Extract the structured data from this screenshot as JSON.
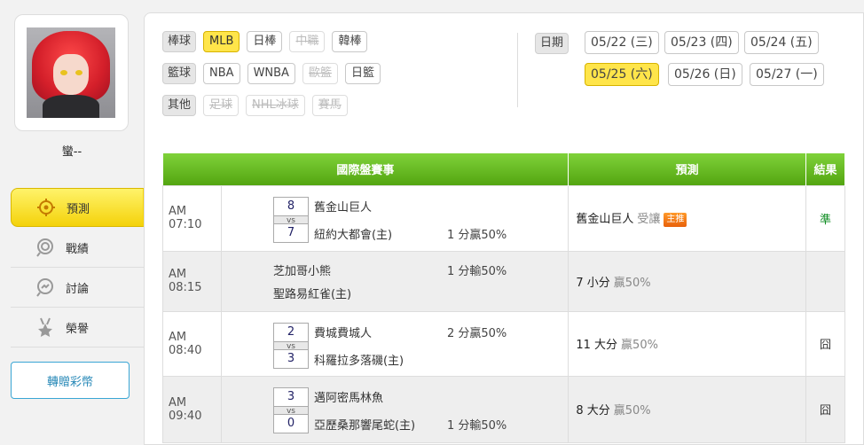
{
  "user": {
    "name": "蠻--"
  },
  "menu": [
    {
      "label": "預測",
      "icon": "target-icon",
      "active": true
    },
    {
      "label": "戰績",
      "icon": "record-icon",
      "active": false
    },
    {
      "label": "討論",
      "icon": "discuss-icon",
      "active": false
    },
    {
      "label": "榮譽",
      "icon": "medal-icon",
      "active": false
    }
  ],
  "gift_button": "轉贈彩幣",
  "filters": {
    "baseball": {
      "label": "棒球",
      "options": [
        "MLB",
        "日棒",
        "中職",
        "韓棒"
      ]
    },
    "basketball": {
      "label": "籃球",
      "options": [
        "NBA",
        "WNBA",
        "歐籃",
        "日籃"
      ]
    },
    "other": {
      "label": "其他",
      "options": [
        "足球",
        "NHL冰球",
        "賽馬"
      ]
    }
  },
  "dates": {
    "label": "日期",
    "options": [
      "05/22 (三)",
      "05/23 (四)",
      "05/24 (五)",
      "05/25 (六)",
      "05/26 (日)",
      "05/27 (一)"
    ],
    "selected": "05/25 (六)"
  },
  "table": {
    "headers": [
      "國際盤賽事",
      "預測",
      "結果"
    ],
    "rows": [
      {
        "time": "AM 07:10",
        "away_score": "8",
        "home_score": "7",
        "vs": "vs",
        "away": "舊金山巨人",
        "home": "紐約大都會(主)",
        "line": "1 分贏50%",
        "line_pos": "home",
        "pred_team": "舊金山巨人",
        "pred_sub": "受讓",
        "badge": "主推",
        "result": "準"
      },
      {
        "time": "AM 08:15",
        "away": "芝加哥小熊",
        "home": "聖路易紅雀(主)",
        "line": "1 分輸50%",
        "line_pos": "away",
        "pred_team": "7 小分",
        "pred_sub": "贏50%",
        "result": ""
      },
      {
        "time": "AM 08:40",
        "away_score": "2",
        "home_score": "3",
        "vs": "vs",
        "away": "費城費城人",
        "home": "科羅拉多落磯(主)",
        "line": "2 分贏50%",
        "line_pos": "away",
        "pred_team": "11 大分",
        "pred_sub": "贏50%",
        "result": "囧"
      },
      {
        "time": "AM 09:40",
        "away_score": "3",
        "home_score": "0",
        "vs": "vs",
        "away": "邁阿密馬林魚",
        "home": "亞歷桑那響尾蛇(主)",
        "line": "1 分輸50%",
        "line_pos": "home",
        "pred_team": "8 大分",
        "pred_sub": "贏50%",
        "result": "囧"
      }
    ]
  }
}
